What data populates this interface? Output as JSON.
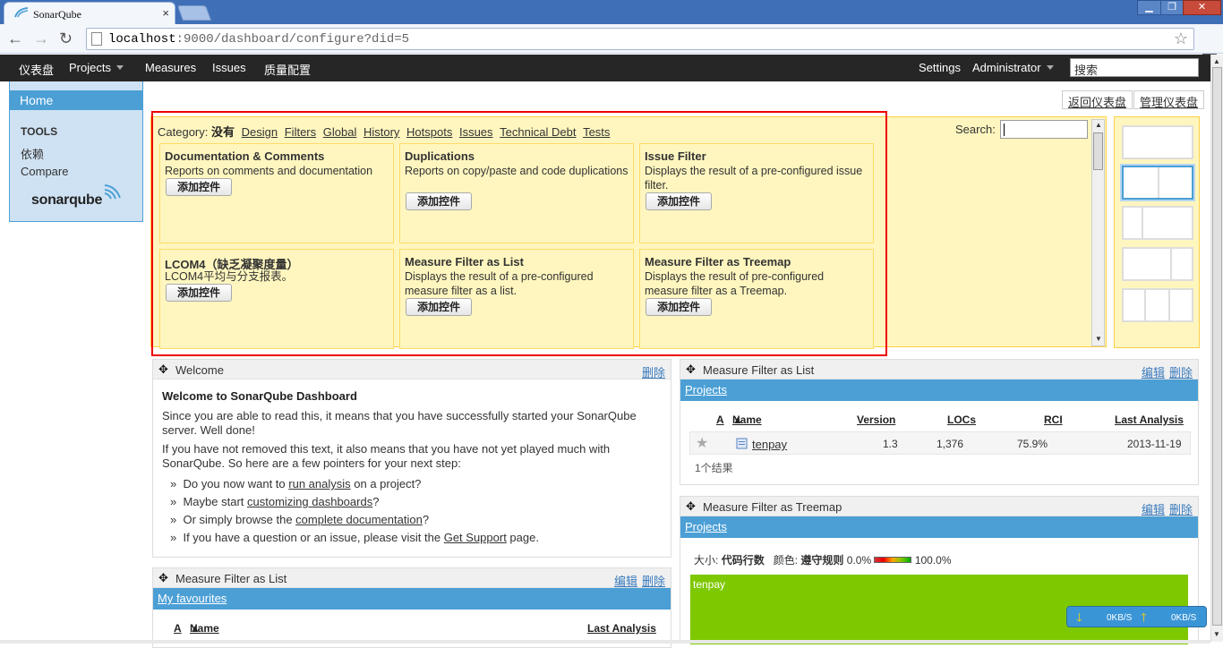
{
  "browser": {
    "tab_title": "SonarQube",
    "tab_close": "×",
    "url_host": "localhost",
    "url_rest": ":9000/dashboard/configure?did=5",
    "win_min": "▁",
    "win_max": "❐",
    "win_close": "✕"
  },
  "nav": {
    "dashboards": "仪表盘",
    "projects": "Projects",
    "measures": "Measures",
    "issues": "Issues",
    "quality": "质量配置",
    "settings": "Settings",
    "admin": "Administrator",
    "search_placeholder": "搜索"
  },
  "sidebar": {
    "home": "Home",
    "tools": "TOOLS",
    "dependencies": "依赖",
    "compare": "Compare",
    "logo_sonar": "sonar",
    "logo_qube": "qube"
  },
  "top_buttons": {
    "back": "返回仪表盘",
    "manage": "管理仪表盘"
  },
  "catalog": {
    "category_label": "Category:",
    "category_none": "没有",
    "categories": [
      "Design",
      "Filters",
      "Global",
      "History",
      "Hotspots",
      "Issues",
      "Technical Debt",
      "Tests"
    ],
    "search_label": "Search:",
    "add_label": "添加控件",
    "widgets": [
      {
        "title": "Documentation & Comments",
        "desc": "Reports on comments and documentation"
      },
      {
        "title": "Duplications",
        "desc": "Reports on copy/paste and code duplications"
      },
      {
        "title": "Issue Filter",
        "desc": "Displays the result of a pre-configured issue filter."
      },
      {
        "title": "LCOM4（缺乏凝聚度量）",
        "desc": "LCOM4平均与分支报表。"
      },
      {
        "title": "Measure Filter as List",
        "desc": "Displays the result of a pre-configured measure filter as a list."
      },
      {
        "title": "Measure Filter as Treemap",
        "desc": "Displays the result of pre-configured measure filter as a Treemap."
      }
    ]
  },
  "welcome": {
    "header": "Welcome",
    "delete": "删除",
    "title": "Welcome to SonarQube Dashboard",
    "p1": "Since you are able to read this, it means that you have successfully started your SonarQube server. Well done!",
    "p2": "If you have not removed this text, it also means that you have not yet played much with SonarQube. So here are a few pointers for your next step:",
    "b1_pre": "Do you now want to ",
    "b1_link": "run analysis",
    "b1_post": " on a project?",
    "b2_pre": "Maybe start ",
    "b2_link": "customizing dashboards",
    "b2_post": "?",
    "b3_pre": "Or simply browse the ",
    "b3_link": "complete documentation",
    "b3_post": "?",
    "b4_pre": "If you have a question or an issue, please visit the ",
    "b4_link": "Get Support",
    "b4_post": " page.",
    "bullet": "»"
  },
  "mf_list_right": {
    "header": "Measure Filter as List",
    "edit": "编辑",
    "delete": "删除",
    "filter_name": "Projects",
    "columns": {
      "a": "A",
      "name": "Name",
      "version": "Version",
      "locs": "LOCs",
      "rci": "RCI",
      "last": "Last Analysis"
    },
    "row": {
      "name": "tenpay",
      "version": "1.3",
      "locs": "1,376",
      "rci": "75.9%",
      "last": "2013-11-19"
    },
    "count": "1个结果"
  },
  "mf_treemap": {
    "header": "Measure Filter as Treemap",
    "edit": "编辑",
    "delete": "删除",
    "filter_name": "Projects",
    "size_label": "大小:",
    "size_value": "代码行数",
    "color_label": "颜色:",
    "color_value": "遵守规则",
    "range_min": "0.0%",
    "range_max": "100.0%",
    "cell": "tenpay",
    "cell_color": "#7ec800"
  },
  "mf_list_left": {
    "header": "Measure Filter as List",
    "edit": "编辑",
    "delete": "删除",
    "filter_name": "My favourites",
    "col_a": "A",
    "col_name": "Name",
    "col_last": "Last Analysis"
  },
  "speed": {
    "down": "0KB/S",
    "up": "0KB/S"
  },
  "colors": {
    "accent": "#4b9fd5",
    "catalog_bg": "#fff6bf",
    "highlight_border": "#ee0000",
    "nav_bg": "#262626"
  }
}
